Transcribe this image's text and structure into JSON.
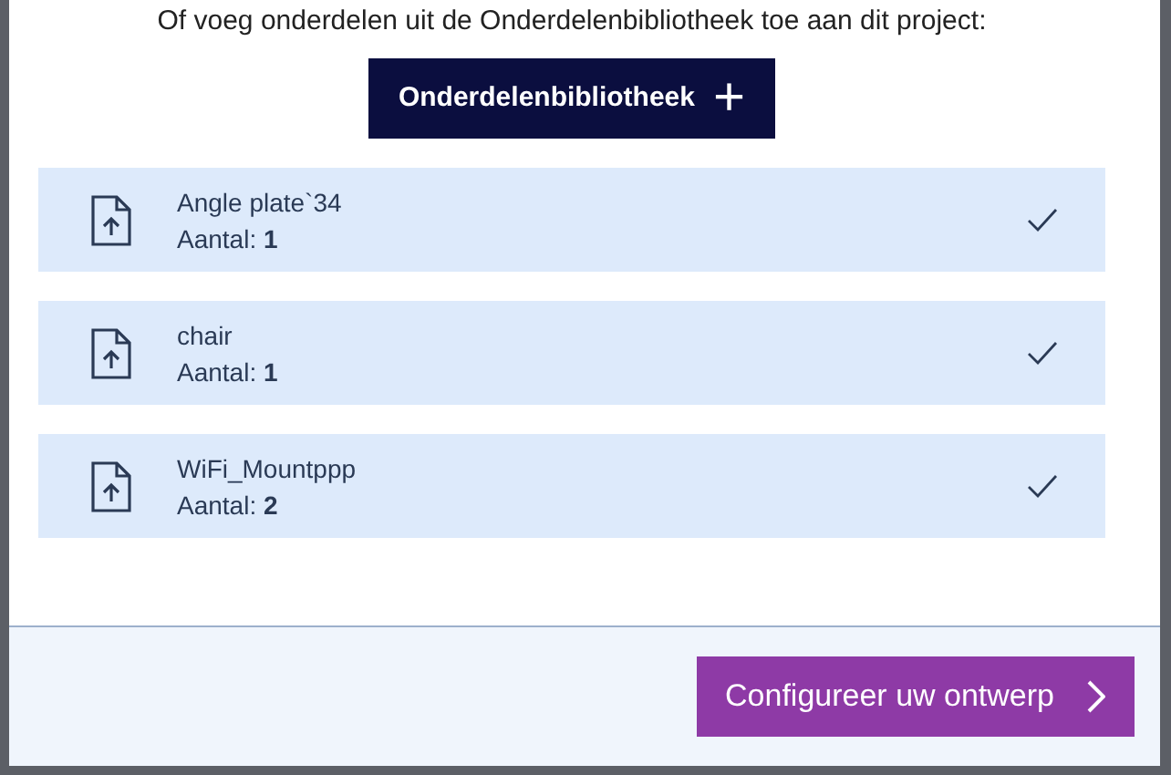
{
  "intro": "Of voeg onderdelen uit de Onderdelenbibliotheek toe aan dit project:",
  "library_button": {
    "label": "Onderdelenbibliotheek",
    "icon": "+"
  },
  "parts": [
    {
      "name": "Angle plate`34",
      "quantity_label": "Aantal:",
      "quantity": "1",
      "done": true
    },
    {
      "name": "chair",
      "quantity_label": "Aantal:",
      "quantity": "1",
      "done": true
    },
    {
      "name": "WiFi_Mountppp",
      "quantity_label": "Aantal:",
      "quantity": "2",
      "done": true
    }
  ],
  "footer": {
    "button": "Configureer uw ontwerp"
  }
}
